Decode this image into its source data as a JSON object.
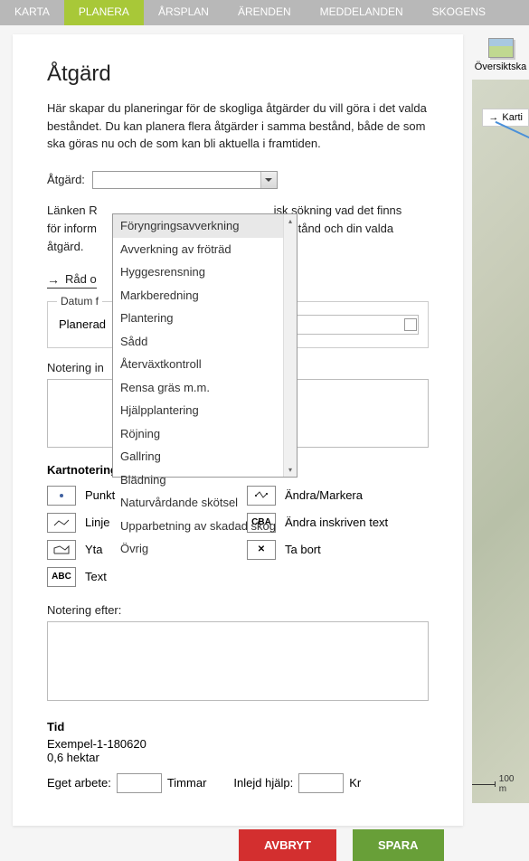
{
  "nav": {
    "items": [
      {
        "label": "KARTA"
      },
      {
        "label": "PLANERA"
      },
      {
        "label": "ÅRSPLAN"
      },
      {
        "label": "ÄRENDEN"
      },
      {
        "label": "MEDDELANDEN"
      },
      {
        "label": "SKOGENS"
      }
    ]
  },
  "page": {
    "title": "Åtgärd",
    "intro": "Här skapar du planeringar för de skogliga åtgärder du vill göra i det valda beståndet. Du kan planera flera åtgärder i samma bestånd, både de som ska göras nu och de som kan bli aktuella i framtiden."
  },
  "atgard": {
    "label": "Åtgärd:",
    "options": [
      "Föryngringsavverkning",
      "Avverkning av fröträd",
      "Hyggesrensning",
      "Markberedning",
      "Plantering",
      "Sådd",
      "Återväxtkontroll",
      "Rensa gräs m.m.",
      "Hjälpplantering",
      "Röjning",
      "Gallring",
      "Blädning",
      "Naturvårdande skötsel",
      "Upparbetning av skadad skog",
      "Övrig"
    ]
  },
  "partial_text": {
    "line1_left": "Länken R",
    "line1_right": "isk sökning vad det finns",
    "line2_left": "för inform",
    "line2_right": "la bestånd och din valda",
    "line3": "åtgärd."
  },
  "link": {
    "label": "Råd o"
  },
  "date_section": {
    "legend": "Datum f",
    "label": "Planerad"
  },
  "notes": {
    "before_label": "Notering in",
    "after_label": "Notering efter:"
  },
  "kart": {
    "title": "Kartnoteringar",
    "items": [
      {
        "label": "Punkt",
        "icon": "dot"
      },
      {
        "label": "Ändra/Markera",
        "icon": "edit"
      },
      {
        "label": "Linje",
        "icon": "line"
      },
      {
        "label": "Ändra inskriven text",
        "icon": "CBA"
      },
      {
        "label": "Yta",
        "icon": "poly"
      },
      {
        "label": "Ta bort",
        "icon": "x"
      },
      {
        "label": "Text",
        "icon": "ABC"
      }
    ]
  },
  "tid": {
    "title": "Tid",
    "example": "Exempel-1-180620",
    "area": "0,6 hektar",
    "own_work_label": "Eget arbete:",
    "own_work_unit": "Timmar",
    "hired_label": "Inlejd hjälp:",
    "hired_unit": "Kr"
  },
  "buttons": {
    "cancel": "AVBRYT",
    "save": "SPARA"
  },
  "sidebar": {
    "overview_label": "Översiktska",
    "map_tab": "Karti",
    "scale": "100 m"
  }
}
